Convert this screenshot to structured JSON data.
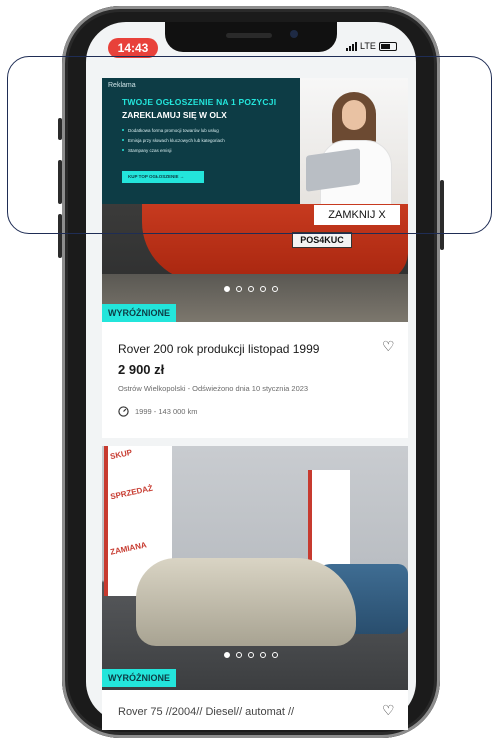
{
  "status_bar": {
    "time": "14:43",
    "network": "LTE"
  },
  "ad": {
    "label": "Reklama",
    "headline": "TWOJE OGŁOSZENIE NA 1 POZYCJI",
    "subheadline": "ZAREKLAMUJ SIĘ W OLX",
    "bullets": [
      "Dodatkowa forma promocji towarów lub usług",
      "Emisja przy słowach kluczowych lub kategoriach",
      "Stampany czas emisji"
    ],
    "cta": "KUP TOP OGŁOSZENIE →",
    "close_label": "ZAMKNIJ X"
  },
  "listings": [
    {
      "badge": "WYRÓŻNIONE",
      "title": "Rover 200 rok produkcji listopad 1999",
      "price": "2 900 zł",
      "location": "Ostrów Wielkopolski - Odświeżono dnia 10 stycznia 2023",
      "meta": "1999 - 143 000 km",
      "plate": "POS4KUC",
      "image_count": 5,
      "active_image": 1
    },
    {
      "badge": "WYRÓŻNIONE",
      "title": "Rover 75 //2004// Diesel// automat //",
      "flag_texts": [
        "SKUP",
        "SPRZEDAŻ",
        "ZAMIANA"
      ],
      "image_count": 5,
      "active_image": 1
    }
  ],
  "colors": {
    "accent": "#23e5db",
    "ad_bg": "#0d3c45",
    "time_pill": "#e8413a"
  }
}
